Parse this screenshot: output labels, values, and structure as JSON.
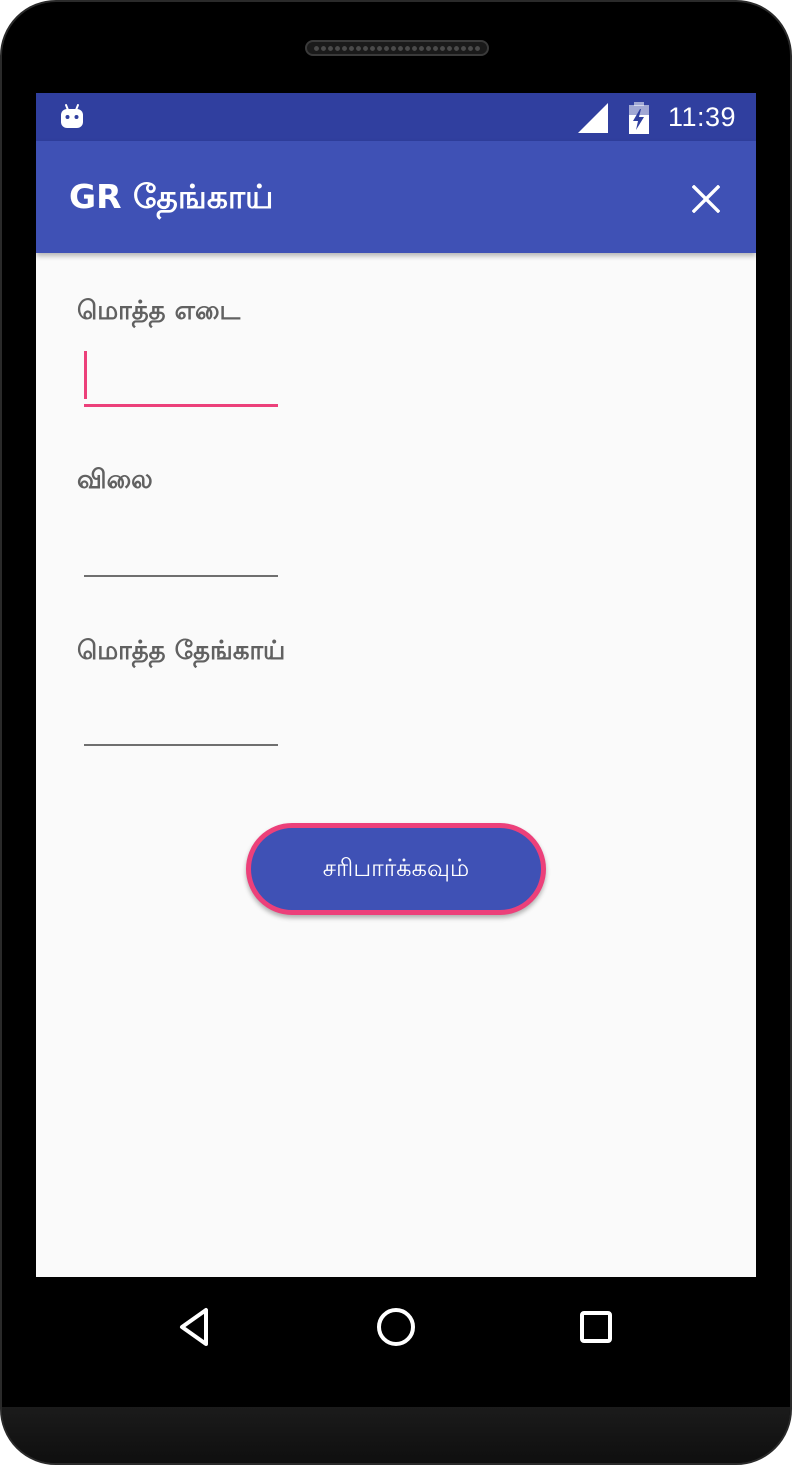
{
  "status_bar": {
    "time": "11:39",
    "icons": [
      "android-debug-icon",
      "cell-signal-icon",
      "battery-charging-icon"
    ]
  },
  "app_bar": {
    "title": "GR தேங்காய்",
    "close_icon": "close-icon"
  },
  "form": {
    "total_weight": {
      "label": "மொத்த எடை",
      "value": "",
      "focused": true
    },
    "price": {
      "label": "விலை",
      "value": ""
    },
    "total_coconut": {
      "label": "மொத்த தேங்காய்",
      "value": ""
    },
    "check_button_label": "சரிபார்க்கவும்"
  },
  "navigation": {
    "back_icon": "back-triangle-icon",
    "home_icon": "home-circle-icon",
    "recents_icon": "recents-square-icon"
  },
  "colors": {
    "status_bar": "#303f9f",
    "app_bar": "#3f51b5",
    "accent": "#ec407a",
    "background": "#fafafa",
    "label_text": "#616161"
  }
}
